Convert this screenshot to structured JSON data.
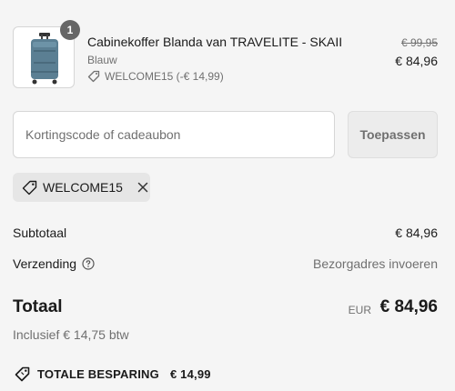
{
  "cart_item": {
    "quantity": "1",
    "name": "Cabinekoffer Blanda van TRAVELITE - SKAII",
    "variant": "Blauw",
    "discount_note": "WELCOME15 (-€ 14,99)",
    "original_price": "€ 99,95",
    "price": "€ 84,96",
    "image_icon": "suitcase-icon"
  },
  "discount": {
    "placeholder": "Kortingscode of cadeaubon",
    "value": "",
    "apply_label": "Toepassen",
    "applied_code": "WELCOME15"
  },
  "summary": {
    "subtotal_label": "Subtotaal",
    "subtotal_value": "€ 84,96",
    "shipping_label": "Verzending",
    "shipping_value": "Bezorgadres invoeren",
    "total_label": "Totaal",
    "total_currency": "EUR",
    "total_value": "€ 84,96",
    "vat_note": "Inclusief € 14,75 btw",
    "savings_label": "TOTALE BESPARING",
    "savings_value": "€ 14,99"
  },
  "colors": {
    "background": "#f5f5f5",
    "text": "#1a1a1a",
    "muted": "#707070",
    "suitcase": "#5b7f93"
  }
}
